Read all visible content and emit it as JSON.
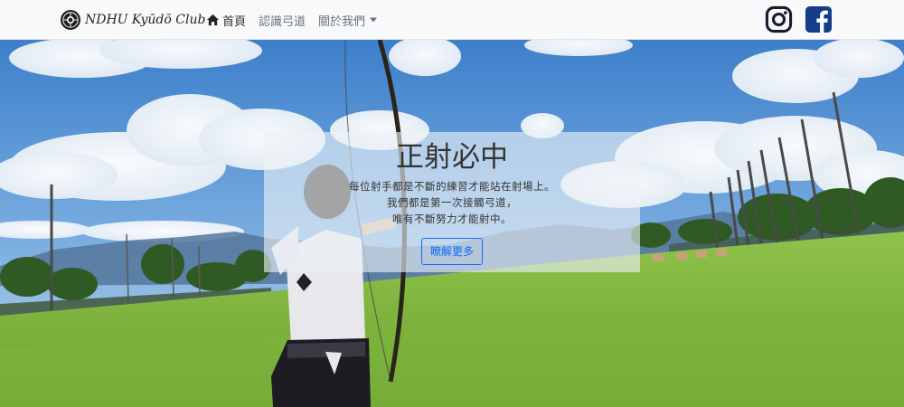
{
  "navbar": {
    "brand_text": "NDHU Kyūdō Club",
    "links": [
      {
        "label": "首頁",
        "icon": "home-icon",
        "active": true
      },
      {
        "label": "認識弓道"
      },
      {
        "label": "關於我們",
        "dropdown": true
      }
    ],
    "social": [
      {
        "icon": "instagram-icon"
      },
      {
        "icon": "facebook-icon"
      }
    ]
  },
  "hero": {
    "title": "正射必中",
    "lines": [
      "每位射手都是不斷的練習才能站在射場上。",
      "我們都是第一次接觸弓道，",
      "唯有不斷努力才能射中。"
    ],
    "button_label": "瞭解更多"
  },
  "colors": {
    "navbar_bg": "#f8f9fa",
    "brand_text": "#222222",
    "nav_link": "#6c757d",
    "accent": "#0d6efd",
    "instagram": "#1a1a2e",
    "facebook": "#153d8a"
  }
}
